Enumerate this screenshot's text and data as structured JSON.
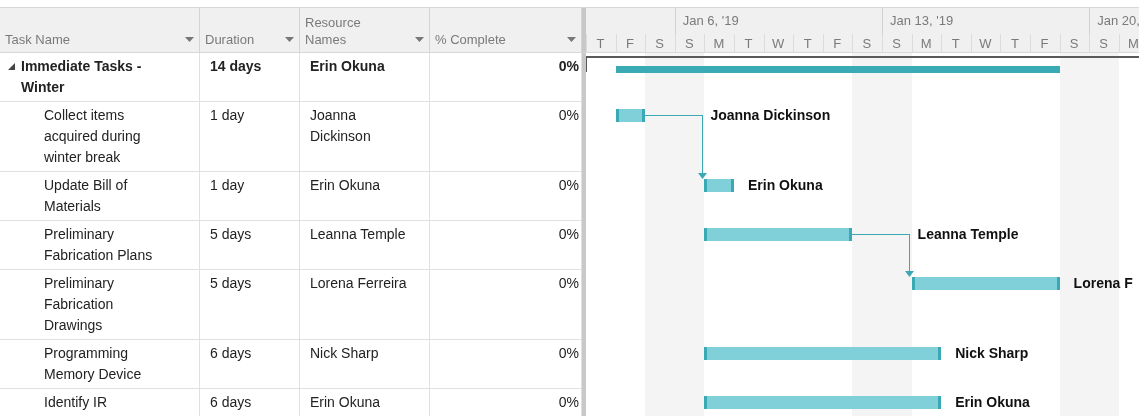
{
  "table": {
    "columns": [
      {
        "label": "Task Name"
      },
      {
        "label": "Duration"
      },
      {
        "label": "Resource Names"
      },
      {
        "label": "% Complete"
      }
    ],
    "rows": [
      {
        "kind": "summary",
        "expanded": true,
        "task": "Immediate Tasks - Winter",
        "duration": "14 days",
        "resource": "Erin Okuna",
        "complete": "0%",
        "link_to_next": false
      },
      {
        "kind": "task",
        "task": "Collect items acquired during winter break",
        "duration": "1 day",
        "resource": "Joanna Dickinson",
        "complete": "0%",
        "bar_label": "Joanna Dickinson",
        "link_to_next": true
      },
      {
        "kind": "task",
        "task": "Update Bill of Materials",
        "duration": "1 day",
        "resource": "Erin Okuna",
        "complete": "0%",
        "bar_label": "Erin Okuna",
        "link_to_next": false
      },
      {
        "kind": "task",
        "task": "Preliminary Fabrication Plans",
        "duration": "5 days",
        "resource": "Leanna Temple",
        "complete": "0%",
        "bar_label": "Leanna Temple",
        "link_to_next": true
      },
      {
        "kind": "task",
        "task": "Preliminary Fabrication Drawings",
        "duration": "5 days",
        "resource": "Lorena Ferreira",
        "complete": "0%",
        "bar_label": "Lorena F",
        "link_to_next": false
      },
      {
        "kind": "task",
        "task": "Programming Memory Device",
        "duration": "6 days",
        "resource": "Nick Sharp",
        "complete": "0%",
        "bar_label": "Nick Sharp",
        "link_to_next": false
      },
      {
        "kind": "task",
        "task": "Identify IR",
        "duration": "6 days",
        "resource": "Erin Okuna",
        "complete": "0%",
        "bar_label": "Erin Okuna",
        "link_to_next": false
      }
    ]
  },
  "timescale": {
    "days": [
      {
        "label": "T",
        "weekend": false
      },
      {
        "label": "F",
        "weekend": false
      },
      {
        "label": "S",
        "weekend": true
      },
      {
        "label": "S",
        "weekend": true,
        "week_label": "Jan 6, '19"
      },
      {
        "label": "M",
        "weekend": false
      },
      {
        "label": "T",
        "weekend": false
      },
      {
        "label": "W",
        "weekend": false
      },
      {
        "label": "T",
        "weekend": false
      },
      {
        "label": "F",
        "weekend": false
      },
      {
        "label": "S",
        "weekend": true
      },
      {
        "label": "S",
        "weekend": true,
        "week_label": "Jan 13, '19"
      },
      {
        "label": "M",
        "weekend": false
      },
      {
        "label": "T",
        "weekend": false
      },
      {
        "label": "W",
        "weekend": false
      },
      {
        "label": "T",
        "weekend": false
      },
      {
        "label": "F",
        "weekend": false
      },
      {
        "label": "S",
        "weekend": true
      },
      {
        "label": "S",
        "weekend": true,
        "week_label": "Jan 20,"
      },
      {
        "label": "M",
        "weekend": false
      }
    ]
  }
}
